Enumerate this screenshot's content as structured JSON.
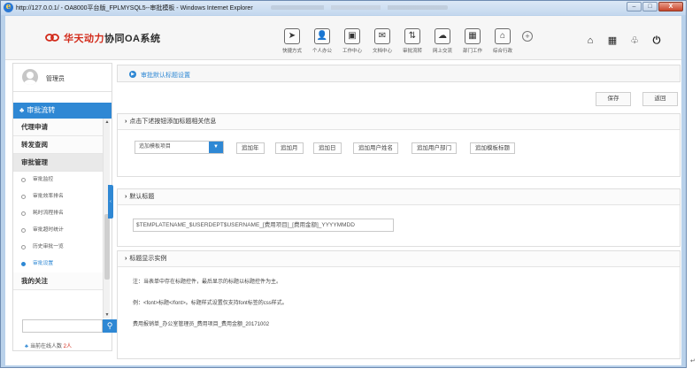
{
  "window": {
    "title": "http://127.0.0.1/ - OA8000平台版_FPLMYSQL5--审批模板 - Windows Internet Explorer",
    "min": "–",
    "max": "□",
    "close": "X"
  },
  "header": {
    "brand_prefix": "华天动力",
    "brand_rest": "协同OA系统",
    "nav": [
      {
        "label": "快捷方式",
        "icon": "send-icon",
        "glyph": "➤"
      },
      {
        "label": "个人办公",
        "icon": "person-icon",
        "glyph": "👤"
      },
      {
        "label": "工作中心",
        "icon": "briefcase-icon",
        "glyph": "▣"
      },
      {
        "label": "文档中心",
        "icon": "document-icon",
        "glyph": "✉"
      },
      {
        "label": "审批流转",
        "icon": "flow-icon",
        "glyph": "⇅"
      },
      {
        "label": "网上交流",
        "icon": "chat-icon",
        "glyph": "☁"
      },
      {
        "label": "部门工作",
        "icon": "calendar-icon",
        "glyph": "▦"
      },
      {
        "label": "综合行政",
        "icon": "building-icon",
        "glyph": "⌂"
      }
    ],
    "add": "+",
    "right_icons": [
      {
        "name": "home-icon",
        "glyph": "⌂"
      },
      {
        "name": "grid-icon",
        "glyph": "▦"
      },
      {
        "name": "shirt-icon",
        "glyph": "♧"
      },
      {
        "name": "power-icon",
        "glyph": "⏻"
      }
    ]
  },
  "sidebar": {
    "user_name": "管理员",
    "menu_title": "审批流转",
    "groups": [
      {
        "label": "代理申请",
        "type": "group"
      },
      {
        "label": "转发查阅",
        "type": "group"
      },
      {
        "label": "审批管理",
        "type": "group",
        "active": true
      },
      {
        "label": "审批监控",
        "type": "sub"
      },
      {
        "label": "审批效率排名",
        "type": "sub"
      },
      {
        "label": "耗时流程排名",
        "type": "sub"
      },
      {
        "label": "审批超时统计",
        "type": "sub"
      },
      {
        "label": "历史审批一览",
        "type": "sub"
      },
      {
        "label": "审批设置",
        "type": "sub",
        "selected": true
      },
      {
        "label": "我的关注",
        "type": "group"
      }
    ],
    "online_label": "当前在线人数",
    "online_count": "2人"
  },
  "main": {
    "breadcrumb": "审批默认标题设置",
    "save_label": "保存",
    "back_label": "返回",
    "section1_title": "点击下述按钮添加标题相关信息",
    "select_value": "追加模板项目",
    "add_buttons": [
      "追加年",
      "追加月",
      "追加日",
      "追加用户姓名",
      "追加用户部门",
      "追加模板标题"
    ],
    "section2_title": "默认标题",
    "default_title": "$TEMPLATENAME_$USERDEPT$USERNAME_[费用项目]_[费用金额]_YYYYMMDD",
    "section3_title": "标题显示实例",
    "note1": "注：当表单中存在标题控件，最后显示的标题以标题控件为主。",
    "note2": "例：<font>标题</font>。标题样式设置仅支持font标签的css样式。",
    "note3": "费用报销单_办公室管理员_费用项目_费用金额_20171002"
  },
  "colors": {
    "accent": "#2f88d4",
    "brand_red": "#d22a1a"
  }
}
